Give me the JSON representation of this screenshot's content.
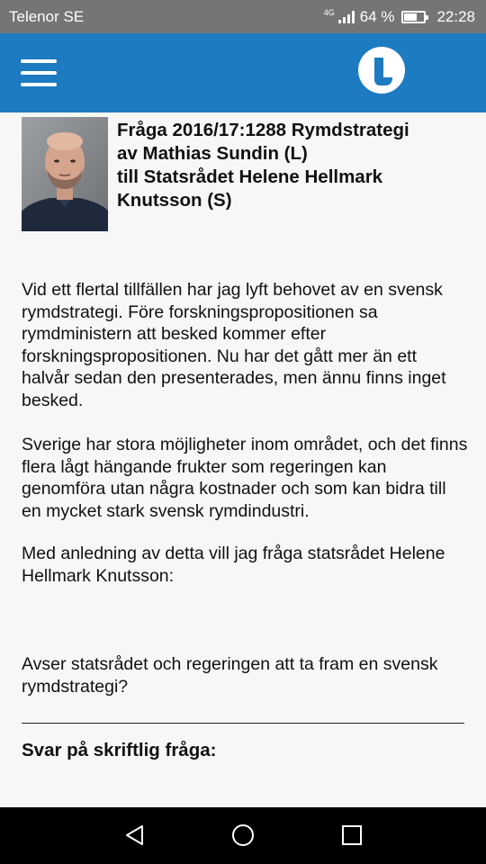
{
  "status_bar": {
    "carrier": "Telenor SE",
    "network_type": "4G",
    "battery_percent": "64 %",
    "battery_level": 0.64,
    "time": "22:28"
  },
  "header": {
    "menu_icon": "hamburger-menu-icon",
    "logo_icon": "liberalerna-logo"
  },
  "question": {
    "title_line1": "Fråga 2016/17:1288 Rymdstrategi",
    "title_line2": "av Mathias Sundin (L)",
    "title_line3": "till Statsrådet Helene Hellmark",
    "title_line4": "Knutsson (S)",
    "paragraph1": "Vid ett flertal tillfällen har jag lyft behovet av en svensk rymdstrategi. Före forskningspropositionen sa rymdministern att besked kommer efter forskningspropositionen. Nu har det gått mer än ett halvår sedan den presenterades, men ännu finns inget besked.",
    "paragraph2": "Sverige har stora möjligheter inom området, och det finns flera lågt hängande frukter som regeringen kan genomföra utan några kostnader och som kan bidra till en mycket stark svensk rymdindustri.",
    "paragraph3": "Med anledning av detta vill jag fråga statsrådet Helene Hellmark Knutsson:",
    "paragraph4": "Avser statsrådet och regeringen att ta fram en svensk rymdstrategi?"
  },
  "answer": {
    "heading": "Svar på skriftlig fråga:"
  },
  "nav_bar": {
    "back_icon": "back-triangle-icon",
    "home_icon": "home-circle-icon",
    "recents_icon": "recents-square-icon"
  }
}
